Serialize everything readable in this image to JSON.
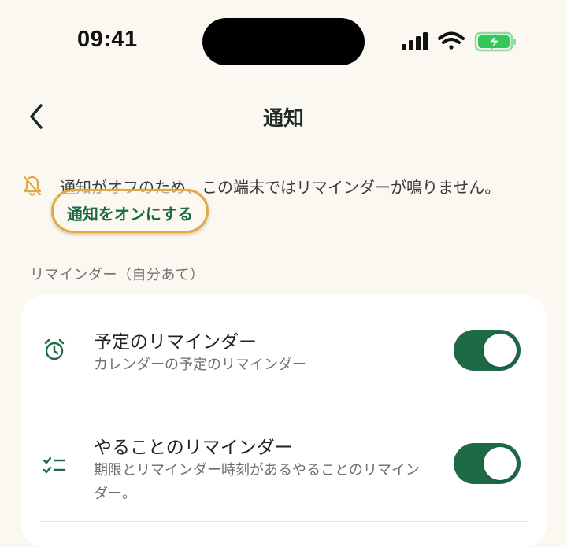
{
  "status_bar": {
    "time": "09:41",
    "battery_color": "#34c759"
  },
  "header": {
    "title": "通知",
    "back_icon": "chevron-left-icon"
  },
  "banner": {
    "icon": "bell-off-icon",
    "icon_color": "#e2a842",
    "message": "通知がオフのため、この端末ではリマインダーが鳴りません。",
    "action_label": "通知をオンにする",
    "highlight_color": "#e2a842"
  },
  "section": {
    "label": "リマインダー（自分あて）",
    "items": [
      {
        "icon": "alarm-clock-icon",
        "title": "予定のリマインダー",
        "subtitle": "カレンダーの予定のリマインダー",
        "enabled": true
      },
      {
        "icon": "checklist-icon",
        "title": "やることのリマインダー",
        "subtitle": "期限とリマインダー時刻があるやることのリマインダー。",
        "enabled": true
      }
    ]
  },
  "colors": {
    "accent": "#1d6a47",
    "background": "#faf8f1",
    "card": "#ffffff"
  }
}
